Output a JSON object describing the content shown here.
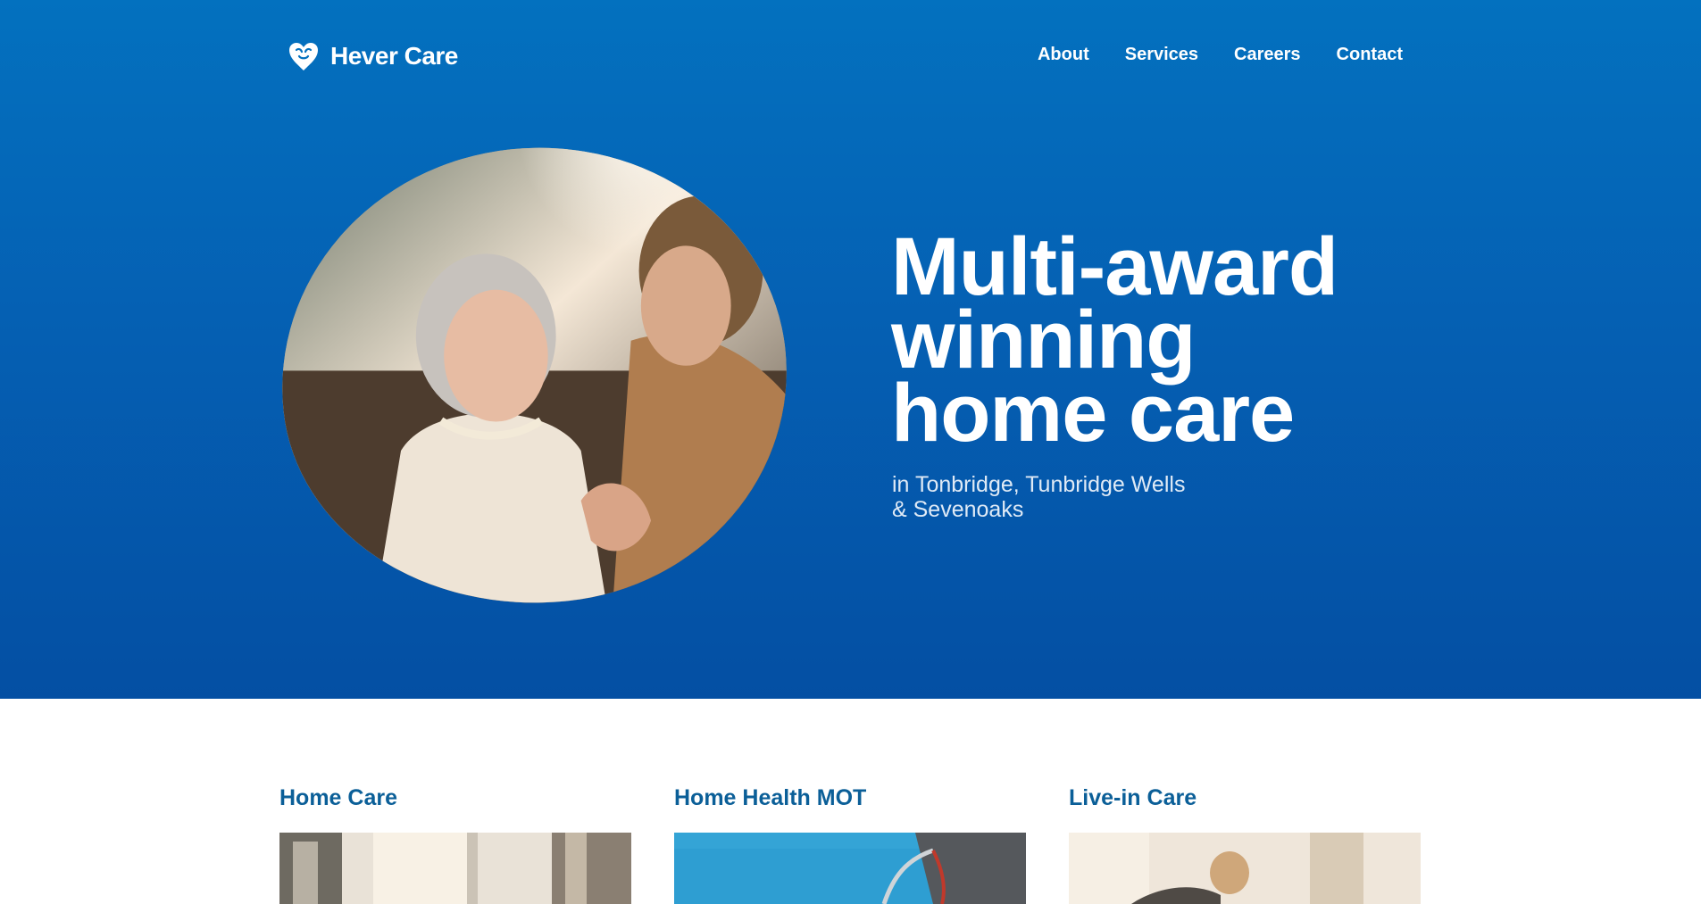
{
  "brand": {
    "name": "Hever Care"
  },
  "nav": {
    "items": [
      {
        "label": "About"
      },
      {
        "label": "Services"
      },
      {
        "label": "Careers"
      },
      {
        "label": "Contact"
      }
    ]
  },
  "hero": {
    "headline": [
      "Multi-award",
      "winning",
      "home care"
    ],
    "subline": [
      "in Tonbridge, Tunbridge Wells",
      "& Sevenoaks"
    ],
    "image": "elderly-woman-with-carer-photo"
  },
  "services": [
    {
      "title": "Home Care",
      "image": "home-care-photo"
    },
    {
      "title": "Home Health MOT",
      "image": "blood-pressure-monitor-photo"
    },
    {
      "title": "Live-in Care",
      "image": "live-in-care-photo"
    }
  ],
  "colors": {
    "hero_top": "#0371bf",
    "hero_bottom": "#044fa3",
    "service_title": "#0b5f98",
    "subline": "#dfeaf6"
  }
}
